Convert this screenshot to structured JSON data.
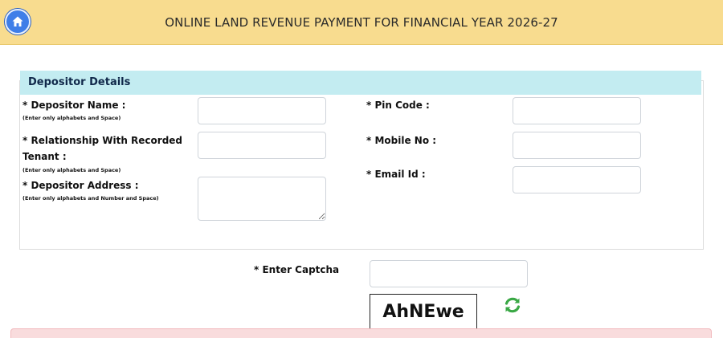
{
  "header": {
    "title": "ONLINE LAND REVENUE PAYMENT FOR FINANCIAL YEAR 2026-27"
  },
  "panel": {
    "heading": "Depositor Details"
  },
  "fields": {
    "depositor_name": {
      "label": "* Depositor Name :",
      "hint": "(Enter only alphabets and Space)",
      "value": ""
    },
    "relationship": {
      "label_line1": "* Relationship With Recorded",
      "label_line2": "Tenant :",
      "hint": "(Enter only alphabets  and Space)",
      "value": ""
    },
    "address": {
      "label": "* Depositor Address :",
      "hint": "(Enter only alphabets and Number and Space)",
      "value": ""
    },
    "pin_code": {
      "label": "* Pin Code :",
      "value": ""
    },
    "mobile": {
      "label": "* Mobile No :",
      "value": ""
    },
    "email": {
      "label": "* Email Id :",
      "value": ""
    }
  },
  "captcha": {
    "label": "* Enter Captcha",
    "value": "",
    "code": "AhNEwe"
  },
  "icons": {
    "home": "home-icon",
    "refresh": "refresh-icon"
  },
  "colors": {
    "header_bg": "#f8dc8f",
    "panel_head_bg": "#c3ecf1",
    "home_blue": "#3f7ee8",
    "refresh_green": "#3aa845",
    "alert_bg": "#f9dcdd"
  }
}
